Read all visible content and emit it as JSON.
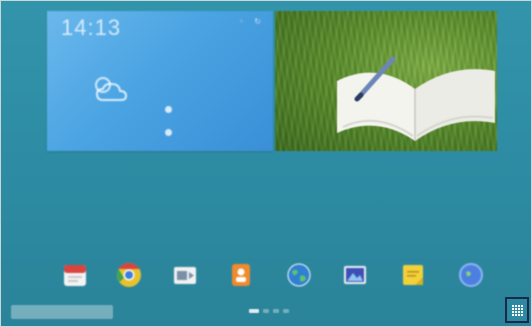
{
  "weather": {
    "time": "14:13",
    "date": "",
    "city": "",
    "info_a": "",
    "info_b": ""
  },
  "dock": {
    "apps": [
      {
        "name": "calendar-app-icon",
        "color": "#d9443f"
      },
      {
        "name": "chrome-app-icon",
        "color": "#e8c12f"
      },
      {
        "name": "video-app-icon",
        "color": "#f2f2f2"
      },
      {
        "name": "contacts-app-icon",
        "color": "#f08a2b"
      },
      {
        "name": "internet-app-icon",
        "color": "#2f7fd3"
      },
      {
        "name": "gallery-app-icon",
        "color": "#3d4fb5"
      },
      {
        "name": "memo-app-icon",
        "color": "#f2d13a"
      },
      {
        "name": "world-clock-app-icon",
        "color": "#4c7fe0"
      }
    ]
  },
  "colors": {
    "background": "#2f8fa6",
    "weather_widget": "#4aa3e2",
    "apps_button_border": "#1c2a4a"
  },
  "page_indicator": {
    "count": 4,
    "active_index": 0
  }
}
